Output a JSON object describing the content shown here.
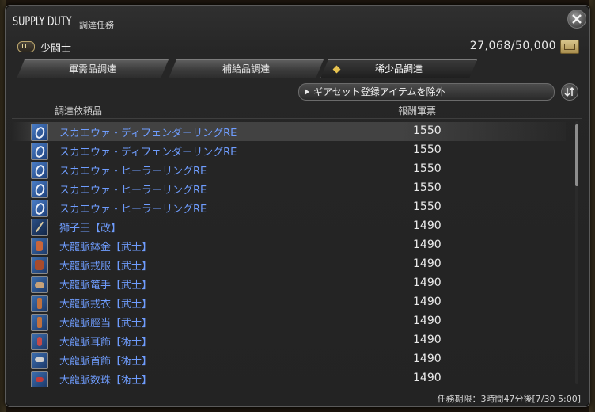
{
  "window": {
    "title": "SUPPLY DUTY",
    "subtitle": "調達任務"
  },
  "rank": {
    "label": "少闘士",
    "seals": "27,068/50,000"
  },
  "tabs": [
    {
      "label": "軍需品調達",
      "active": false
    },
    {
      "label": "補給品調達",
      "active": false
    },
    {
      "label": "稀少品調達",
      "active": true
    }
  ],
  "filter": {
    "label": "ギアセット登録アイテムを除外"
  },
  "columns": {
    "item": "調達依頼品",
    "seals": "報酬軍票"
  },
  "items": [
    {
      "name": "スカエウァ・ディフェンダーリングRE",
      "seals": "1550",
      "icon": "ring-icon",
      "selected": true
    },
    {
      "name": "スカエウァ・ディフェンダーリングRE",
      "seals": "1550",
      "icon": "ring-icon"
    },
    {
      "name": "スカエウァ・ヒーラーリングRE",
      "seals": "1550",
      "icon": "ring-icon"
    },
    {
      "name": "スカエウァ・ヒーラーリングRE",
      "seals": "1550",
      "icon": "ring-icon"
    },
    {
      "name": "スカエウァ・ヒーラーリングRE",
      "seals": "1550",
      "icon": "ring-icon"
    },
    {
      "name": "獅子王【改】",
      "seals": "1490",
      "icon": "katana-icon"
    },
    {
      "name": "大龍脈鉢金【武士】",
      "seals": "1490",
      "icon": "headgear-icon"
    },
    {
      "name": "大龍脈戎服【武士】",
      "seals": "1490",
      "icon": "body-armor-icon"
    },
    {
      "name": "大龍脈篭手【武士】",
      "seals": "1490",
      "icon": "gloves-icon"
    },
    {
      "name": "大龍脈戎衣【武士】",
      "seals": "1490",
      "icon": "legs-armor-icon"
    },
    {
      "name": "大龍脈脛当【武士】",
      "seals": "1490",
      "icon": "greaves-icon"
    },
    {
      "name": "大龍脈耳飾【術士】",
      "seals": "1490",
      "icon": "earring-icon"
    },
    {
      "name": "大龍脈首飾【術士】",
      "seals": "1490",
      "icon": "necklace-icon"
    },
    {
      "name": "大龍脈数珠【術士】",
      "seals": "1490",
      "icon": "bracelet-icon"
    }
  ],
  "footer": {
    "deadline": "任務期限：3時間47分後[7/30 5:00]"
  }
}
